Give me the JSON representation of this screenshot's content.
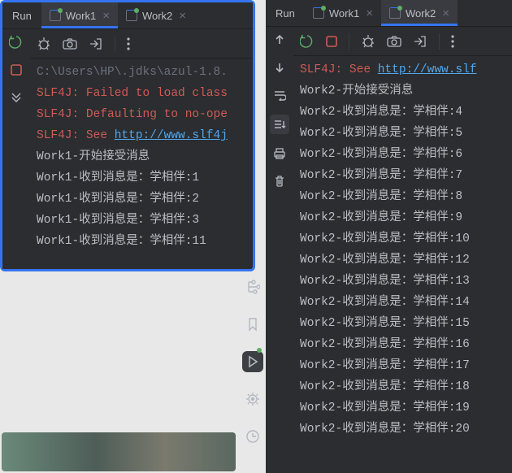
{
  "left": {
    "run": "Run",
    "tabs": [
      {
        "label": "Work1",
        "active": true,
        "running": true
      },
      {
        "label": "Work2",
        "active": false,
        "running": true
      }
    ],
    "console": [
      {
        "cls": "path",
        "text": "C:\\Users\\HP\\.jdks\\azul-1.8."
      },
      {
        "cls": "err",
        "text": "SLF4J: Failed to load class"
      },
      {
        "cls": "err",
        "text": "SLF4J: Defaulting to no-ope"
      },
      {
        "cls": "err",
        "prefix": "SLF4J: See ",
        "link": "http://www.slf4j"
      },
      {
        "cls": "line",
        "text": "Work1-开始接受消息"
      },
      {
        "cls": "line",
        "text": "Work1-收到消息是：学相伴:1"
      },
      {
        "cls": "line",
        "text": "Work1-收到消息是：学相伴:2"
      },
      {
        "cls": "line",
        "text": "Work1-收到消息是：学相伴:3"
      },
      {
        "cls": "line",
        "text": "Work1-收到消息是：学相伴:11"
      }
    ]
  },
  "right": {
    "run": "Run",
    "tabs": [
      {
        "label": "Work1",
        "active": false,
        "running": true
      },
      {
        "label": "Work2",
        "active": true,
        "running": true
      }
    ],
    "console": [
      {
        "cls": "err",
        "prefix": "SLF4J: See ",
        "link": "http://www.slf"
      },
      {
        "cls": "line",
        "text": "Work2-开始接受消息"
      },
      {
        "cls": "line",
        "text": "Work2-收到消息是：学相伴:4"
      },
      {
        "cls": "line",
        "text": "Work2-收到消息是：学相伴:5"
      },
      {
        "cls": "line",
        "text": "Work2-收到消息是：学相伴:6"
      },
      {
        "cls": "line",
        "text": "Work2-收到消息是：学相伴:7"
      },
      {
        "cls": "line",
        "text": "Work2-收到消息是：学相伴:8"
      },
      {
        "cls": "line",
        "text": "Work2-收到消息是：学相伴:9"
      },
      {
        "cls": "line",
        "text": "Work2-收到消息是：学相伴:10"
      },
      {
        "cls": "line",
        "text": "Work2-收到消息是：学相伴:12"
      },
      {
        "cls": "line",
        "text": "Work2-收到消息是：学相伴:13"
      },
      {
        "cls": "line",
        "text": "Work2-收到消息是：学相伴:14"
      },
      {
        "cls": "line",
        "text": "Work2-收到消息是：学相伴:15"
      },
      {
        "cls": "line",
        "text": "Work2-收到消息是：学相伴:16"
      },
      {
        "cls": "line",
        "text": "Work2-收到消息是：学相伴:17"
      },
      {
        "cls": "line",
        "text": "Work2-收到消息是：学相伴:18"
      },
      {
        "cls": "line",
        "text": "Work2-收到消息是：学相伴:19"
      },
      {
        "cls": "line",
        "text": "Work2-收到消息是：学相伴:20"
      }
    ]
  }
}
